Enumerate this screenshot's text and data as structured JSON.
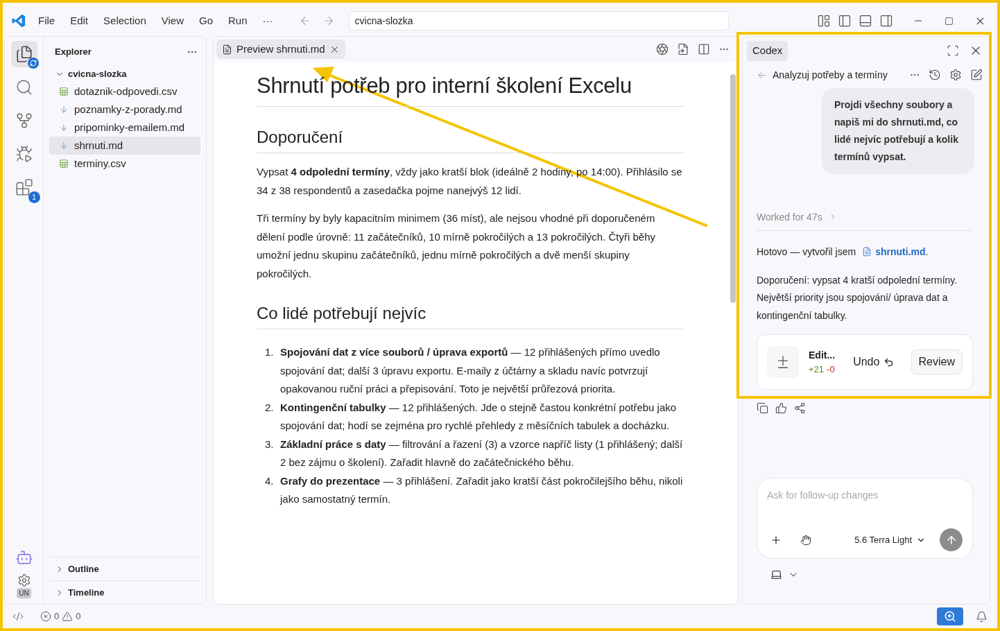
{
  "title_bar": {
    "menu": [
      "File",
      "Edit",
      "Selection",
      "View",
      "Go",
      "Run",
      "···"
    ],
    "search": {
      "value": "cvicna-slozka"
    }
  },
  "activity_bar": {
    "items": [
      {
        "kind": "explorer",
        "selected": true
      },
      {
        "kind": "search",
        "selected": false
      },
      {
        "kind": "source-control",
        "selected": false
      },
      {
        "kind": "run-debug",
        "selected": false
      },
      {
        "kind": "extensions",
        "selected": false,
        "badge": "1"
      }
    ],
    "account": "UN"
  },
  "explorer": {
    "title": "Explorer",
    "folder": {
      "name": "cvicna-slozka",
      "expanded": true,
      "children": [
        {
          "name": "dotaznik-odpovedi.csv",
          "kind": "csv",
          "selected": false
        },
        {
          "name": "poznamky-z-porady.md",
          "kind": "md",
          "selected": false
        },
        {
          "name": "pripominky-emailem.md",
          "kind": "md",
          "selected": false
        },
        {
          "name": "shrnuti.md",
          "kind": "md",
          "selected": true
        },
        {
          "name": "terminy.csv",
          "kind": "csv",
          "selected": false
        }
      ]
    },
    "sections": [
      {
        "label": "Outline",
        "expanded": false
      },
      {
        "label": "Timeline",
        "expanded": false
      }
    ]
  },
  "editor": {
    "tabs": [
      {
        "label": "Preview shrnuti.md",
        "selected": true
      }
    ],
    "document": {
      "title": "Shrnutí potřeb pro interní školení Excelu",
      "sections": [
        {
          "heading": "Doporučení",
          "paragraphs": [
            "Vypsat **4 odpolední termíny**, vždy jako kratší blok (ideálně 2 hodiny, po 14:00). Přihlásilo se 34 z 38 respondentů a zasedačka pojme nanejvýš 12 lidí.",
            "Tři termíny by byly kapacitním minimem (36 míst), ale nejsou vhodné při doporučeném dělení podle úrovně: 11 začátečníků, 10 mírně pokročilých a 13 pokročilých. Čtyři běhy umožní jednu skupinu začátečníků, jednu mírně pokročilých a dvě menší skupiny pokročilých."
          ]
        },
        {
          "heading": "Co lidé potřebují nejvíc",
          "list": [
            {
              "marker": "1.",
              "text": "**Spojování dat z více souborů / úprava exportů** — 12 přihlášených přímo uvedlo spojování dat; další 3 úpravu exportu. E-maily z účtárny a skladu navíc potvrzují opakovanou ruční práci a přepisování. Toto je největší průřezová priorita."
            },
            {
              "marker": "2.",
              "text": "**Kontingenční tabulky** — 12 přihlášených. Jde o stejně častou konkrétní potřebu jako spojování dat; hodí se zejména pro rychlé přehledy z měsíčních tabulek a docházku."
            },
            {
              "marker": "3.",
              "text": "**Základní práce s daty** — filtrování a řazení (3) a vzorce napříč listy (1 přihlášený; další 2 bez zájmu o školení). Zařadit hlavně do začátečnického běhu."
            },
            {
              "marker": "4.",
              "text": "**Grafy do prezentace** — 3 přihlášení. Zařadit jako kratší část pokročilejšího běhu, nikoli jako samostatný termín."
            }
          ]
        }
      ]
    }
  },
  "codex": {
    "tab": "Codex",
    "thread_title": "Analyzuj potřeby a termíny",
    "user_message": "Projdi všechny soubory a napiš mi do shrnuti.md, co lidé nejvíc potřebují a kolik termínů vypsat.",
    "worked": "Worked for 47s",
    "reply": {
      "before": "Hotovo — vytvořil jsem",
      "link": "shrnuti.md",
      "after": "."
    },
    "summary": "Doporučení: vypsat 4 kratší odpolední termíny. Největší priority jsou spojování/ úprava dat a kontingenční tabulky.",
    "edit_card": {
      "label": "Edit...",
      "added": "+21",
      "removed": "-0",
      "undo": "Undo",
      "review": "Review"
    },
    "composer": {
      "placeholder": "Ask for follow-up changes",
      "model": "5.6 Terra Light"
    }
  },
  "status_bar": {
    "errors": "0",
    "warnings": "0"
  }
}
